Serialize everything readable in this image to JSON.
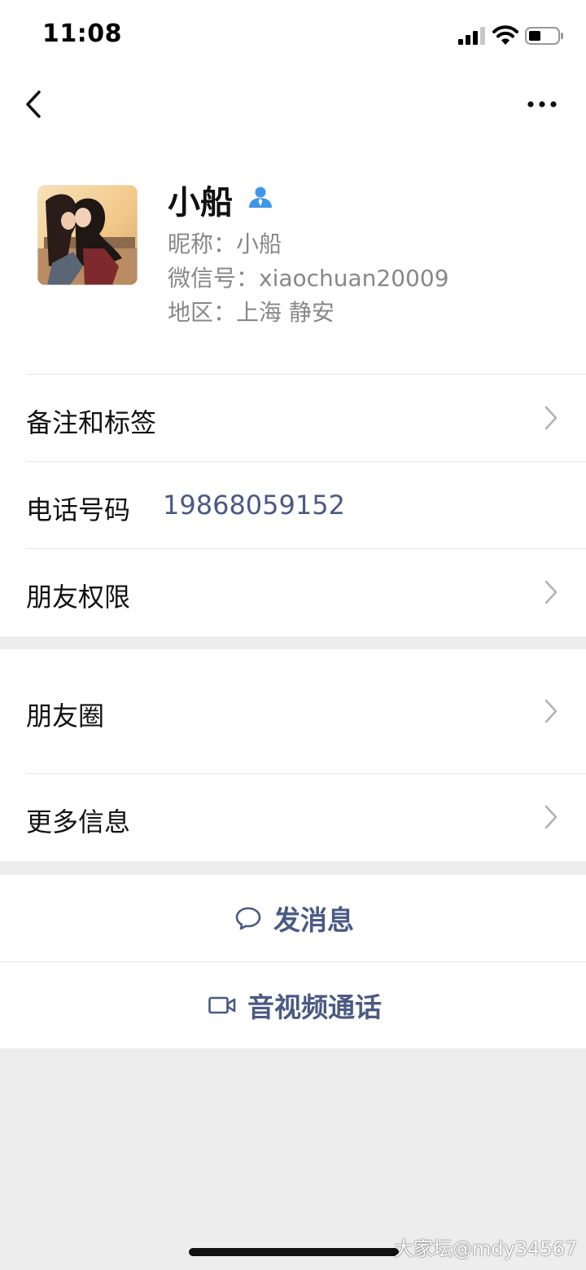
{
  "status_bar": {
    "time": "11:08"
  },
  "nav": {
    "back_icon": "chevron-left-icon",
    "more_icon": "ellipsis-icon"
  },
  "profile": {
    "name": "小船",
    "nickname_line": "昵称：小船",
    "wechat_id_line": "微信号：xiaochuan20009",
    "region_line": "地区：上海 静安",
    "verify_icon": "person-icon",
    "avatar_icon": "avatar-image"
  },
  "rows": {
    "remark_tags": "备注和标签",
    "phone_label": "电话号码",
    "phone_value": "19868059152",
    "friend_permissions": "朋友权限",
    "moments": "朋友圈",
    "more_info": "更多信息"
  },
  "actions": {
    "send_message": "发消息",
    "av_call": "音视频通话"
  },
  "watermark": "大家坛@mdy34567",
  "colors": {
    "link": "#4a5a84",
    "background": "#ededed",
    "verify": "#3f97e8"
  }
}
